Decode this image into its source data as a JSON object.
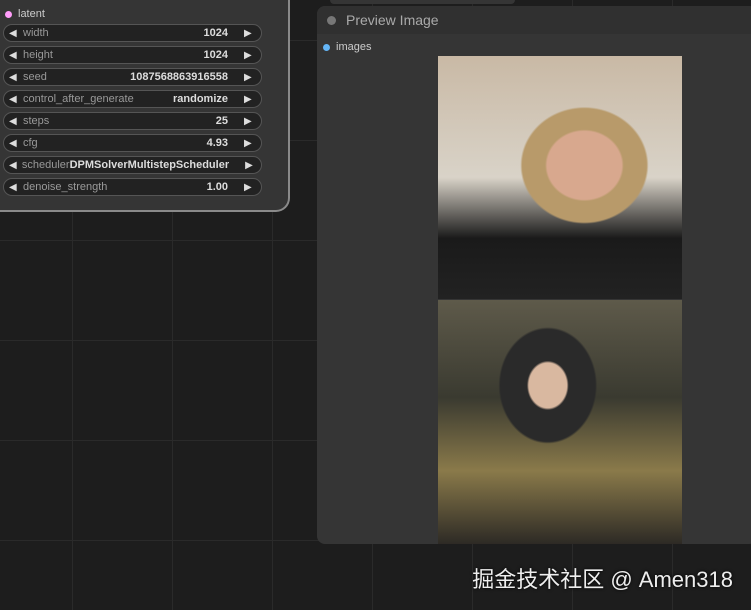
{
  "left_node": {
    "output_slot": "latent",
    "widgets": [
      {
        "label": "width",
        "value": "1024"
      },
      {
        "label": "height",
        "value": "1024"
      },
      {
        "label": "seed",
        "value": "1087568863916558"
      },
      {
        "label": "control_after_generate",
        "value": "randomize"
      },
      {
        "label": "steps",
        "value": "25"
      },
      {
        "label": "cfg",
        "value": "4.93"
      },
      {
        "label": "scheduler",
        "value": "DPMSolverMultistepScheduler"
      },
      {
        "label": "denoise_strength",
        "value": "1.00"
      }
    ],
    "left_arrow": "◀",
    "right_arrow": "▶"
  },
  "preview_node": {
    "title": "Preview Image",
    "input_slot": "images"
  },
  "watermark": "掘金技术社区 @ Amen318",
  "colors": {
    "latent": "#ff9cf9",
    "images": "#64b5f6"
  }
}
